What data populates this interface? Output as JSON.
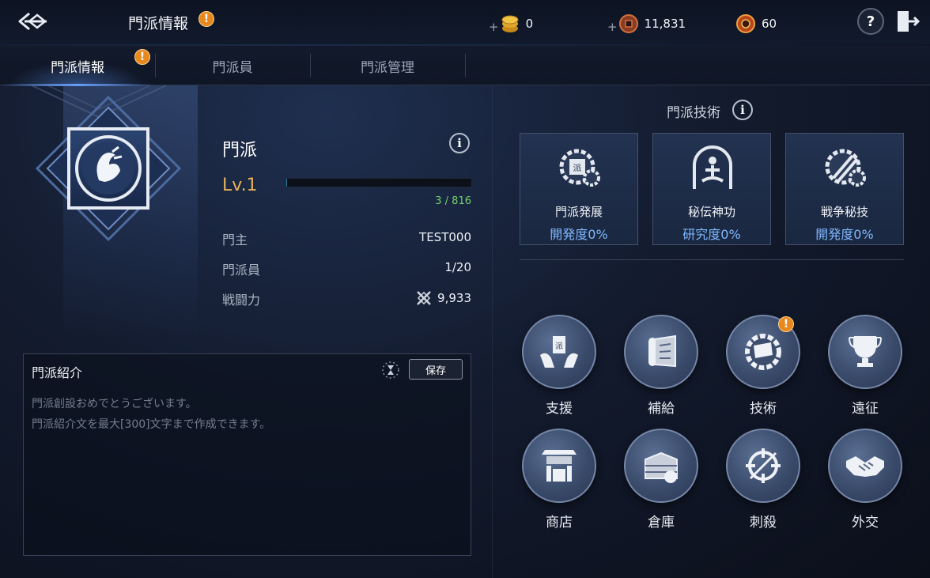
{
  "header": {
    "title": "門派情報",
    "currencies": [
      {
        "name": "gold",
        "value": "0"
      },
      {
        "name": "coin",
        "value": "11,831"
      },
      {
        "name": "gem",
        "value": "60"
      }
    ],
    "help_label": "?"
  },
  "tabs": [
    {
      "label": "門派情報",
      "active": true,
      "alert": true
    },
    {
      "label": "門派員",
      "active": false
    },
    {
      "label": "門派管理",
      "active": false
    }
  ],
  "guild": {
    "name": "門派",
    "level": "Lv.1",
    "exp_text": "3 / 816",
    "exp_fraction": 0.004,
    "stats": [
      {
        "label": "門主",
        "value": "TEST000"
      },
      {
        "label": "門派員",
        "value": "1/20"
      },
      {
        "label": "戦闘力",
        "value": "9,933"
      }
    ]
  },
  "intro": {
    "title": "門派紹介",
    "save_label": "保存",
    "lines": [
      "門派創設おめでとうございます。",
      "門派紹介文を最大[300]文字まで作成できます。"
    ]
  },
  "tech": {
    "title": "門派技術",
    "cards": [
      {
        "name": "門派発展",
        "progress": "開発度0%"
      },
      {
        "name": "秘伝神功",
        "progress": "研究度0%"
      },
      {
        "name": "戦争秘技",
        "progress": "開発度0%"
      }
    ]
  },
  "menu": [
    {
      "label": "支援",
      "icon": "support-icon"
    },
    {
      "label": "補給",
      "icon": "supply-icon"
    },
    {
      "label": "技術",
      "icon": "tech-icon",
      "alert": true
    },
    {
      "label": "遠征",
      "icon": "expedition-icon"
    },
    {
      "label": "商店",
      "icon": "shop-icon"
    },
    {
      "label": "倉庫",
      "icon": "warehouse-icon"
    },
    {
      "label": "刺殺",
      "icon": "assassination-icon"
    },
    {
      "label": "外交",
      "icon": "diplomacy-icon"
    }
  ],
  "colors": {
    "accent_alert": "#e8891f",
    "level": "#e7b25a",
    "exp_text": "#6fd36c",
    "tech_progress": "#7fb8ff"
  }
}
